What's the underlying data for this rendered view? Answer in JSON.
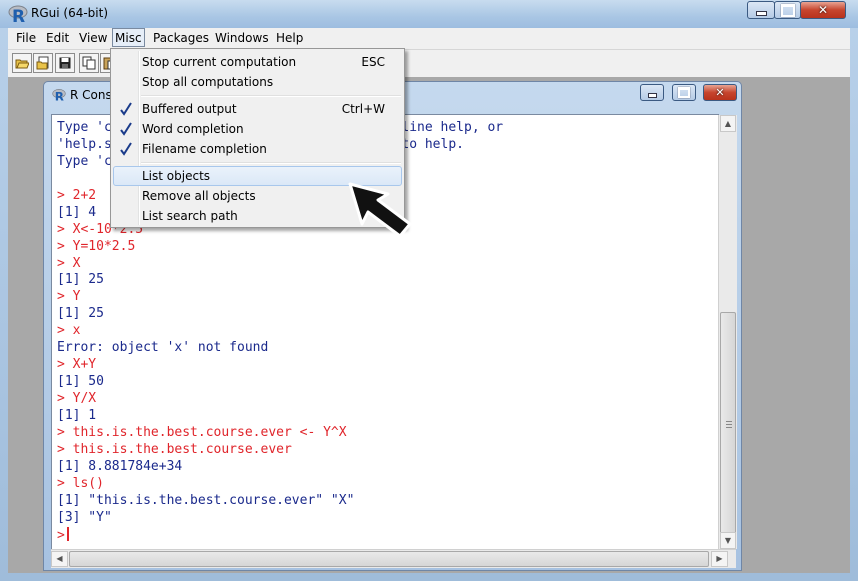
{
  "app": {
    "title": "RGui (64-bit)"
  },
  "menubar": [
    "File",
    "Edit",
    "View",
    "Misc",
    "Packages",
    "Windows",
    "Help"
  ],
  "misc_menu": {
    "items": [
      {
        "label": "Stop current computation",
        "shortcut": "ESC",
        "checked": false
      },
      {
        "label": "Stop all computations",
        "shortcut": "",
        "checked": false
      },
      {
        "label": "Buffered output",
        "shortcut": "Ctrl+W",
        "checked": true
      },
      {
        "label": "Word completion",
        "shortcut": "",
        "checked": true
      },
      {
        "label": "Filename completion",
        "shortcut": "",
        "checked": true
      },
      {
        "label": "List objects",
        "shortcut": "",
        "checked": false,
        "highlighted": true
      },
      {
        "label": "Remove all objects",
        "shortcut": "",
        "checked": false
      },
      {
        "label": "List search path",
        "shortcut": "",
        "checked": false
      }
    ]
  },
  "console": {
    "title": "R Console",
    "lines": [
      {
        "text": "Type 'c                                  on-line help, or",
        "kind": "out"
      },
      {
        "text": "'help.s                                  ce to help.",
        "kind": "out"
      },
      {
        "text": "Type 'c",
        "kind": "out"
      },
      {
        "text": "",
        "kind": "out"
      },
      {
        "text": "> 2+2",
        "kind": "in"
      },
      {
        "text": "[1] 4",
        "kind": "out"
      },
      {
        "text": "> X<-10*2.5",
        "kind": "in"
      },
      {
        "text": "> Y=10*2.5",
        "kind": "in"
      },
      {
        "text": "> X",
        "kind": "in"
      },
      {
        "text": "[1] 25",
        "kind": "out"
      },
      {
        "text": "> Y",
        "kind": "in"
      },
      {
        "text": "[1] 25",
        "kind": "out"
      },
      {
        "text": "> x",
        "kind": "in"
      },
      {
        "text": "Error: object 'x' not found",
        "kind": "out"
      },
      {
        "text": "> X+Y",
        "kind": "in"
      },
      {
        "text": "[1] 50",
        "kind": "out"
      },
      {
        "text": "> Y/X",
        "kind": "in"
      },
      {
        "text": "[1] 1",
        "kind": "out"
      },
      {
        "text": "> this.is.the.best.course.ever <- Y^X",
        "kind": "in"
      },
      {
        "text": "> this.is.the.best.course.ever",
        "kind": "in"
      },
      {
        "text": "[1] 8.881784e+34",
        "kind": "out"
      },
      {
        "text": "> ls()",
        "kind": "in"
      },
      {
        "text": "[1] \"this.is.the.best.course.ever\" \"X\"",
        "kind": "out"
      },
      {
        "text": "[3] \"Y\"",
        "kind": "out"
      }
    ],
    "prompt": ">"
  },
  "icons": {
    "app": "r-logo-icon",
    "toolbar": [
      "open-script-icon",
      "load-workspace-icon",
      "save-icon",
      "copy-icon",
      "paste-icon"
    ],
    "annotation": "arrow-pointer-icon"
  },
  "colors": {
    "input": "#e0252b",
    "output": "#1b2a8c"
  }
}
